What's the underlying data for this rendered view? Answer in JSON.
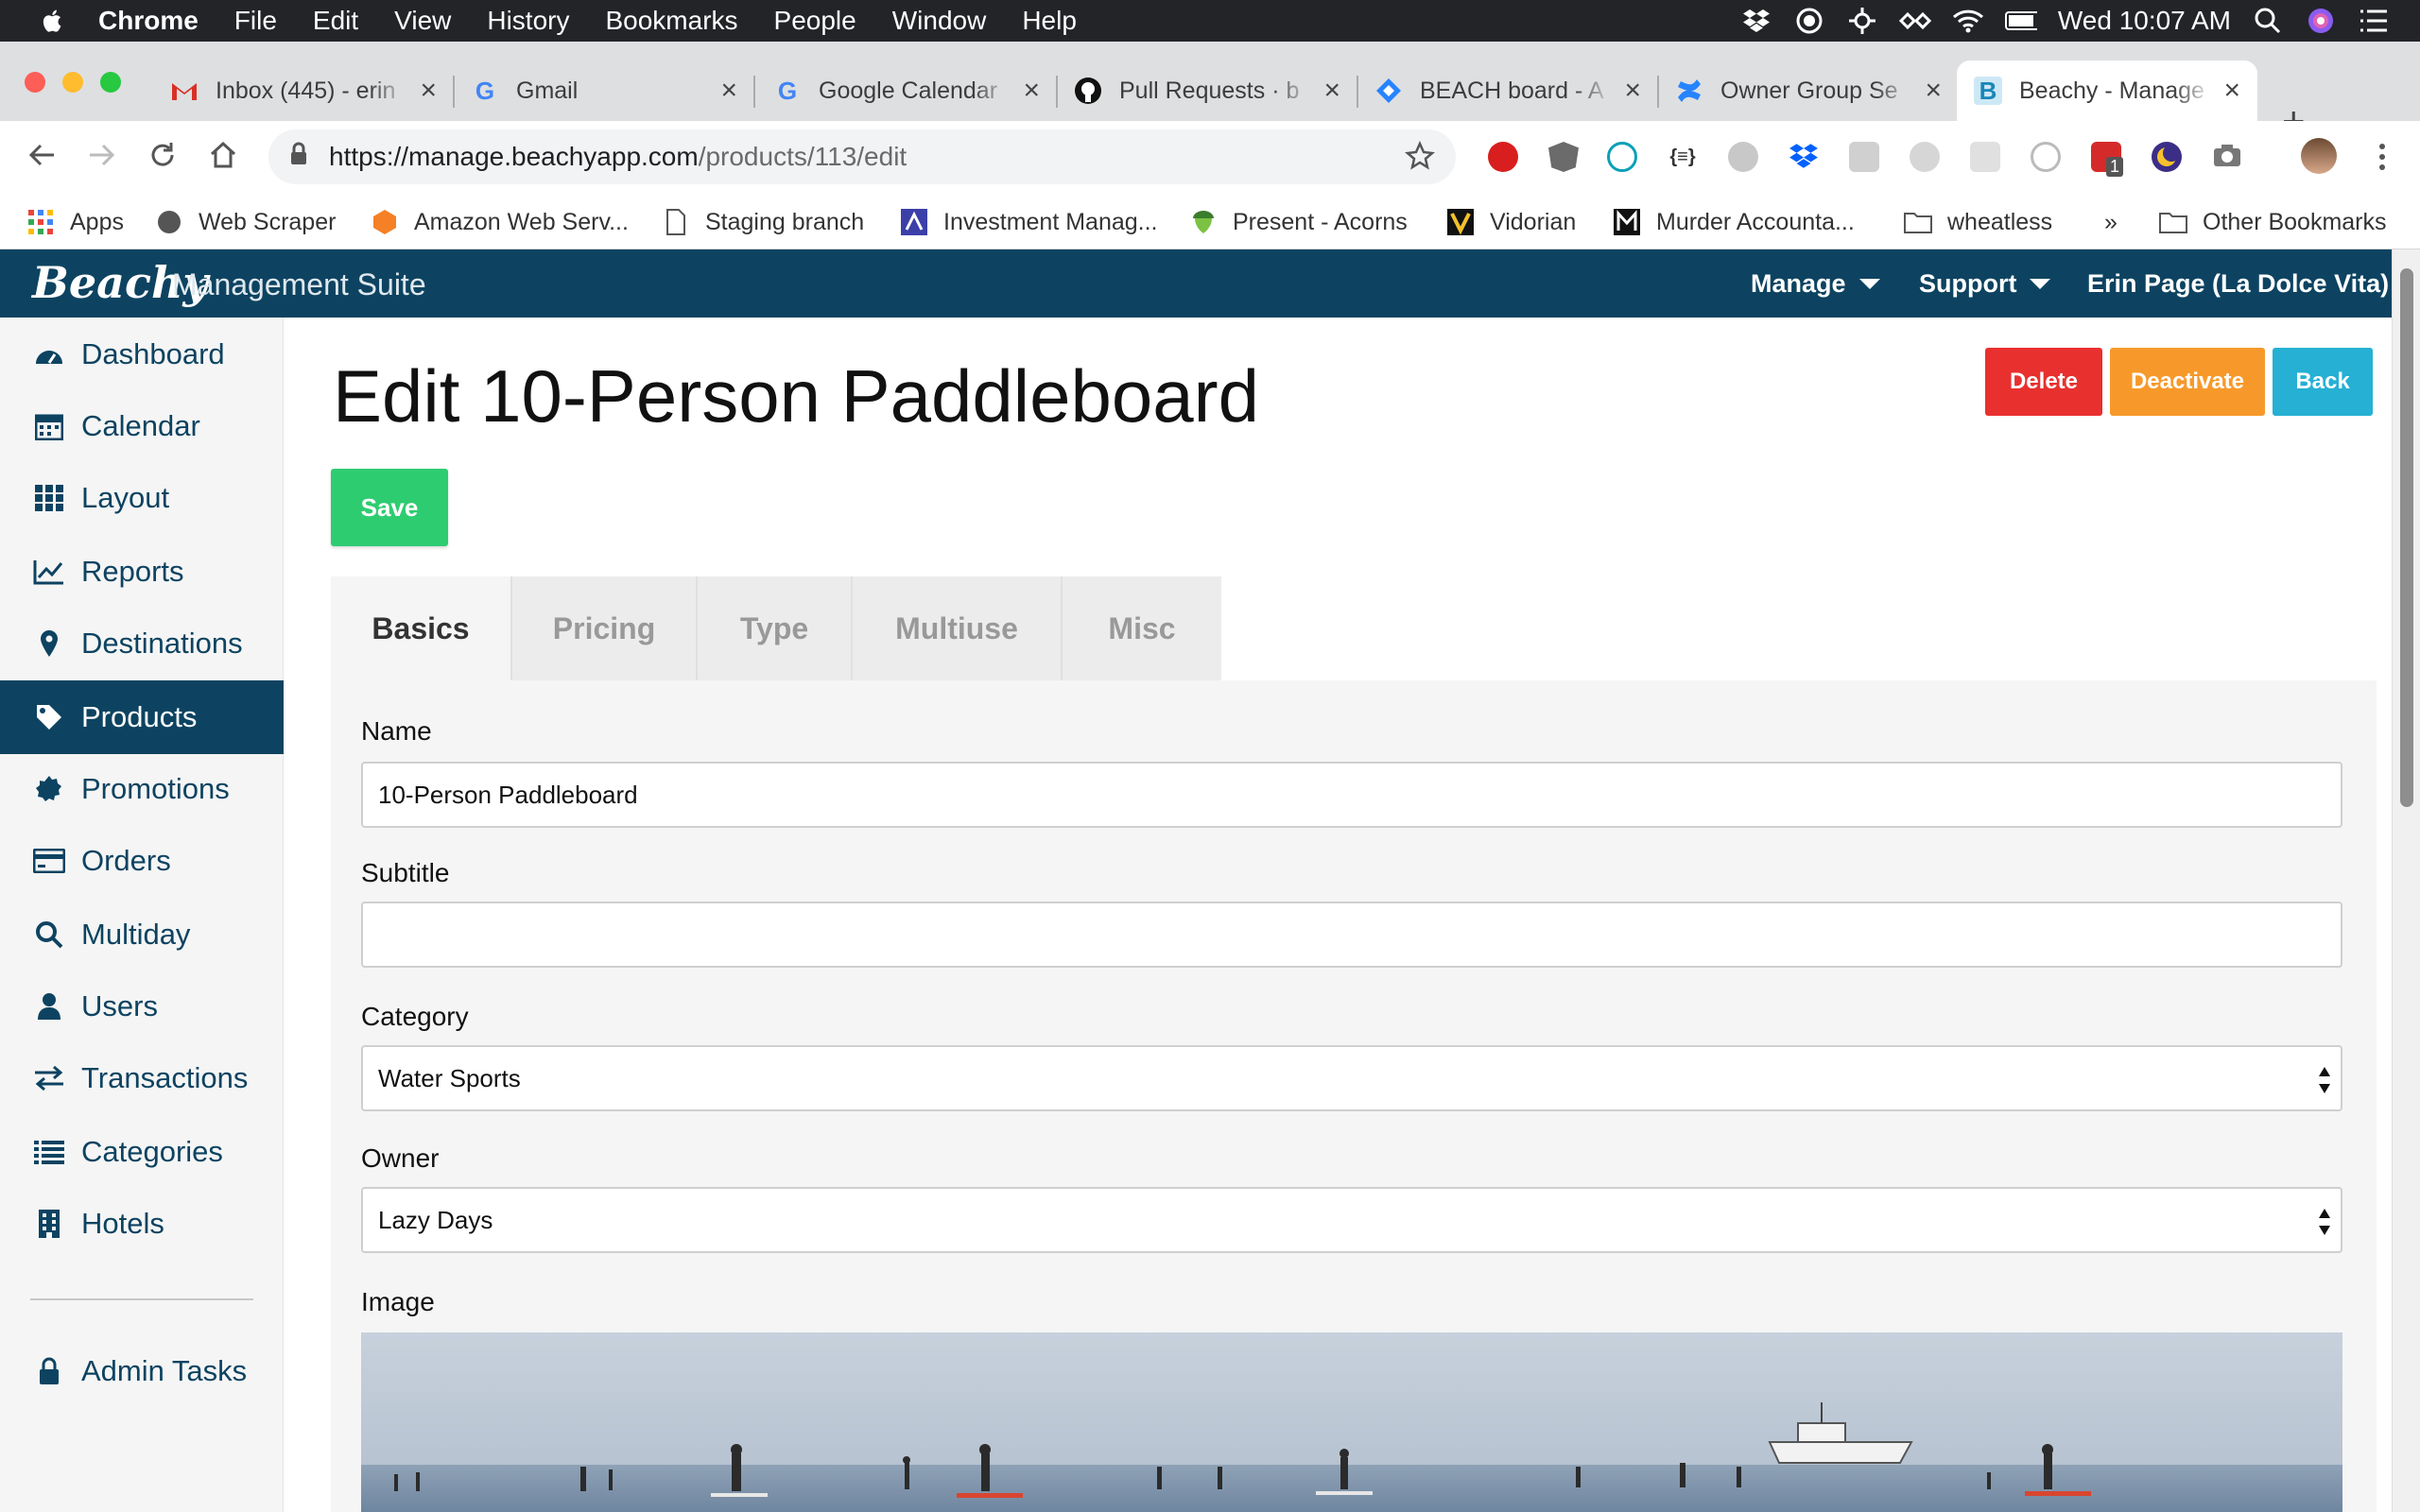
{
  "menubar": {
    "app": "Chrome",
    "items": [
      "File",
      "Edit",
      "View",
      "History",
      "Bookmarks",
      "People",
      "Window",
      "Help"
    ],
    "clock": "Wed 10:07 AM"
  },
  "tabs": [
    {
      "title": "Inbox (445) - erin",
      "icon": "gmail-icon"
    },
    {
      "title": "Gmail",
      "icon": "google-icon"
    },
    {
      "title": "Google Calendar",
      "icon": "google-icon"
    },
    {
      "title": "Pull Requests · b",
      "icon": "github-icon"
    },
    {
      "title": "BEACH board - A",
      "icon": "jira-icon"
    },
    {
      "title": "Owner Group Se",
      "icon": "confluence-icon"
    },
    {
      "title": "Beachy - Manage",
      "icon": "beachy-icon"
    }
  ],
  "address": {
    "host": "https://manage.beachyapp.com",
    "path": "/products/113/edit"
  },
  "extension_badge": "1",
  "bookmarks": [
    {
      "label": "Apps"
    },
    {
      "label": "Web Scraper"
    },
    {
      "label": "Amazon Web Serv..."
    },
    {
      "label": "Staging branch"
    },
    {
      "label": "Investment Manag..."
    },
    {
      "label": "Present - Acorns"
    },
    {
      "label": "Vidorian"
    },
    {
      "label": "Murder Accounta..."
    },
    {
      "label": "wheatless"
    },
    {
      "label": "»"
    },
    {
      "label": "Other Bookmarks"
    }
  ],
  "appnav": {
    "logo": "Beachy",
    "suite": "Management Suite",
    "manage": "Manage",
    "support": "Support",
    "user": "Erin Page (La Dolce Vita)"
  },
  "sidebar": {
    "items": [
      {
        "label": "Dashboard",
        "icon": "dashboard-icon"
      },
      {
        "label": "Calendar",
        "icon": "calendar-icon"
      },
      {
        "label": "Layout",
        "icon": "grid-icon"
      },
      {
        "label": "Reports",
        "icon": "chart-line-icon"
      },
      {
        "label": "Destinations",
        "icon": "map-pin-icon"
      },
      {
        "label": "Products",
        "icon": "tag-icon"
      },
      {
        "label": "Promotions",
        "icon": "badge-icon"
      },
      {
        "label": "Orders",
        "icon": "credit-card-icon"
      },
      {
        "label": "Multiday",
        "icon": "search-icon"
      },
      {
        "label": "Users",
        "icon": "user-icon"
      },
      {
        "label": "Transactions",
        "icon": "exchange-icon"
      },
      {
        "label": "Categories",
        "icon": "list-icon"
      },
      {
        "label": "Hotels",
        "icon": "building-icon"
      }
    ],
    "admin": "Admin Tasks"
  },
  "page": {
    "title": "Edit 10-Person Paddleboard",
    "save": "Save",
    "delete": "Delete",
    "deactivate": "Deactivate",
    "back": "Back",
    "tabs": [
      "Basics",
      "Pricing",
      "Type",
      "Multiuse",
      "Misc"
    ],
    "active_tab": "Basics"
  },
  "form": {
    "name_label": "Name",
    "name_value": "10-Person Paddleboard",
    "subtitle_label": "Subtitle",
    "subtitle_value": "",
    "category_label": "Category",
    "category_value": "Water Sports",
    "owner_label": "Owner",
    "owner_value": "Lazy Days",
    "image_label": "Image"
  },
  "colors": {
    "brand": "#0d4361",
    "save": "#2ecc71",
    "delete": "#e8302f",
    "deactivate": "#f7992a",
    "back": "#25b0d4"
  }
}
